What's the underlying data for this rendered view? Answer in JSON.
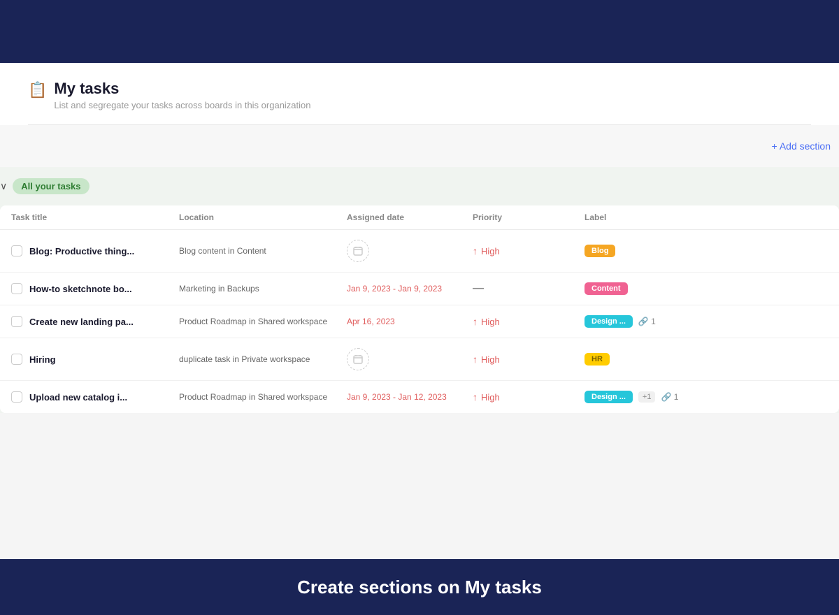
{
  "topBar": {
    "bgColor": "#1a2456"
  },
  "header": {
    "icon": "📋",
    "title": "My tasks",
    "subtitle": "List and segregate your tasks across boards in this organization"
  },
  "toolbar": {
    "addSectionLabel": "+ Add section"
  },
  "section": {
    "title": "All your tasks",
    "chevron": "❯"
  },
  "tableHeaders": [
    "Task title",
    "Location",
    "Assigned date",
    "Priority",
    "Label"
  ],
  "tasks": [
    {
      "id": 1,
      "title": "Blog: Productive thing...",
      "location": "Blog content in Content",
      "assignedDate": null,
      "priority": "High",
      "priorityType": "high",
      "label": "Blog",
      "labelClass": "label-blog",
      "labelCount": null,
      "attachments": null
    },
    {
      "id": 2,
      "title": "How-to sketchnote bo...",
      "location": "Marketing in Backups",
      "assignedDate": "Jan 9, 2023 - Jan 9, 2023",
      "priorityType": "medium",
      "label": "Content",
      "labelClass": "label-content",
      "labelCount": null,
      "attachments": null
    },
    {
      "id": 3,
      "title": "Create new landing pa...",
      "location": "Product Roadmap in Shared workspace",
      "assignedDate": "Apr 16, 2023",
      "assignedDateOverdue": true,
      "priority": "High",
      "priorityType": "high",
      "label": "Design ...",
      "labelClass": "label-design",
      "labelCount": null,
      "attachments": 1
    },
    {
      "id": 4,
      "title": "Hiring",
      "location": "duplicate task in Private workspace",
      "assignedDate": null,
      "priority": "High",
      "priorityType": "high",
      "label": "HR",
      "labelClass": "label-hr",
      "labelCount": null,
      "attachments": null
    },
    {
      "id": 5,
      "title": "Upload new catalog i...",
      "location": "Product Roadmap in Shared workspace",
      "assignedDate": "Jan 9, 2023 - Jan 12, 2023",
      "assignedDateOverdue": true,
      "priority": "High",
      "priorityType": "high",
      "label": "Design ...",
      "labelClass": "label-design",
      "labelCount": "+1",
      "attachments": 1
    }
  ],
  "bottomBanner": {
    "text": "Create sections on My tasks"
  }
}
